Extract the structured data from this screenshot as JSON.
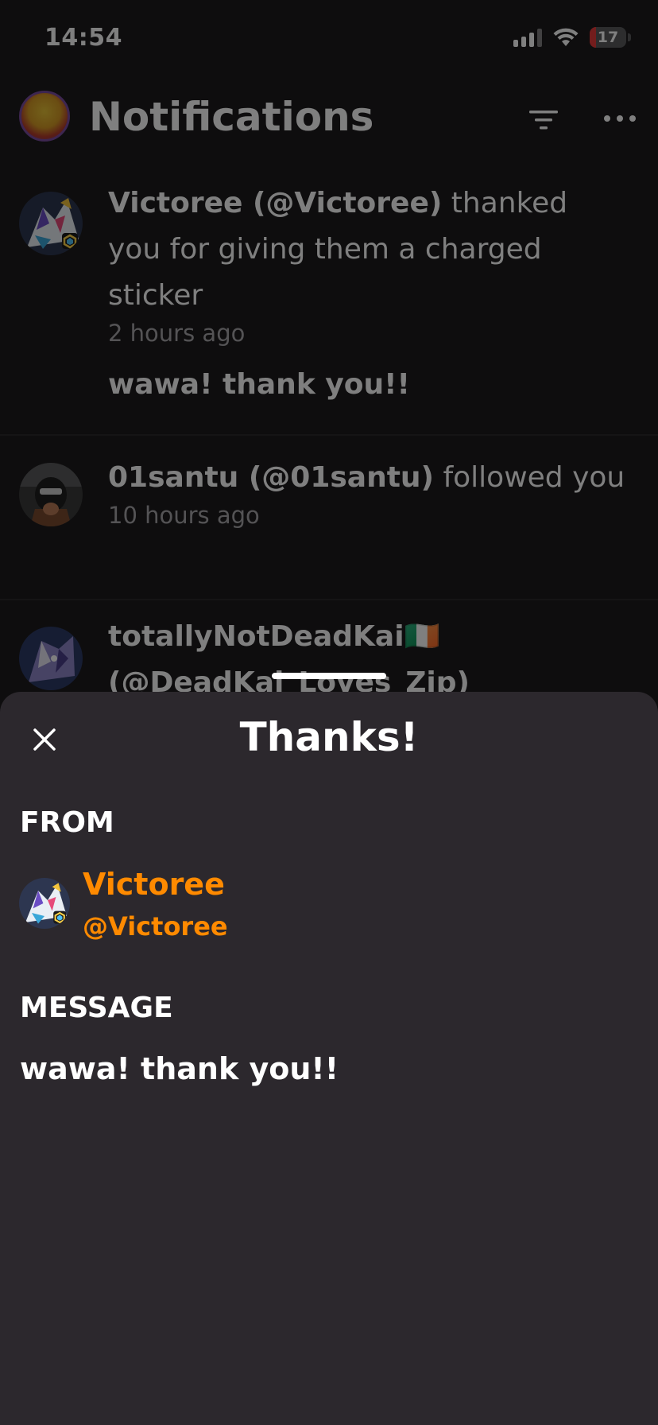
{
  "status_bar": {
    "time": "14:54",
    "battery_level": "17",
    "icons": [
      "signal-icon",
      "wifi-icon",
      "battery-icon"
    ]
  },
  "header": {
    "title": "Notifications",
    "icons": [
      "filter-icon",
      "more-icon"
    ]
  },
  "notifications": [
    {
      "name": "Victoree (@Victoree)",
      "action": " thanked you for giving them a charged sticker",
      "time": "2 hours ago",
      "reply": "wawa! thank you!!"
    },
    {
      "name": "01santu (@01santu)",
      "action": " followed you",
      "time": "10 hours ago"
    },
    {
      "name": "totallyNotDeadKai🇮🇪",
      "handle_partial": "(@DeadKai_Loves_Zip)"
    }
  ],
  "sheet": {
    "title": "Thanks!",
    "from_label": "FROM",
    "from_name": "Victoree",
    "from_handle": "@Victoree",
    "message_label": "MESSAGE",
    "message": "wawa! thank you!!"
  },
  "colors": {
    "background": "#1c1b1d",
    "sheet": "#2c282d",
    "accent": "#ff8a00",
    "battery_low": "#e63b3b"
  }
}
